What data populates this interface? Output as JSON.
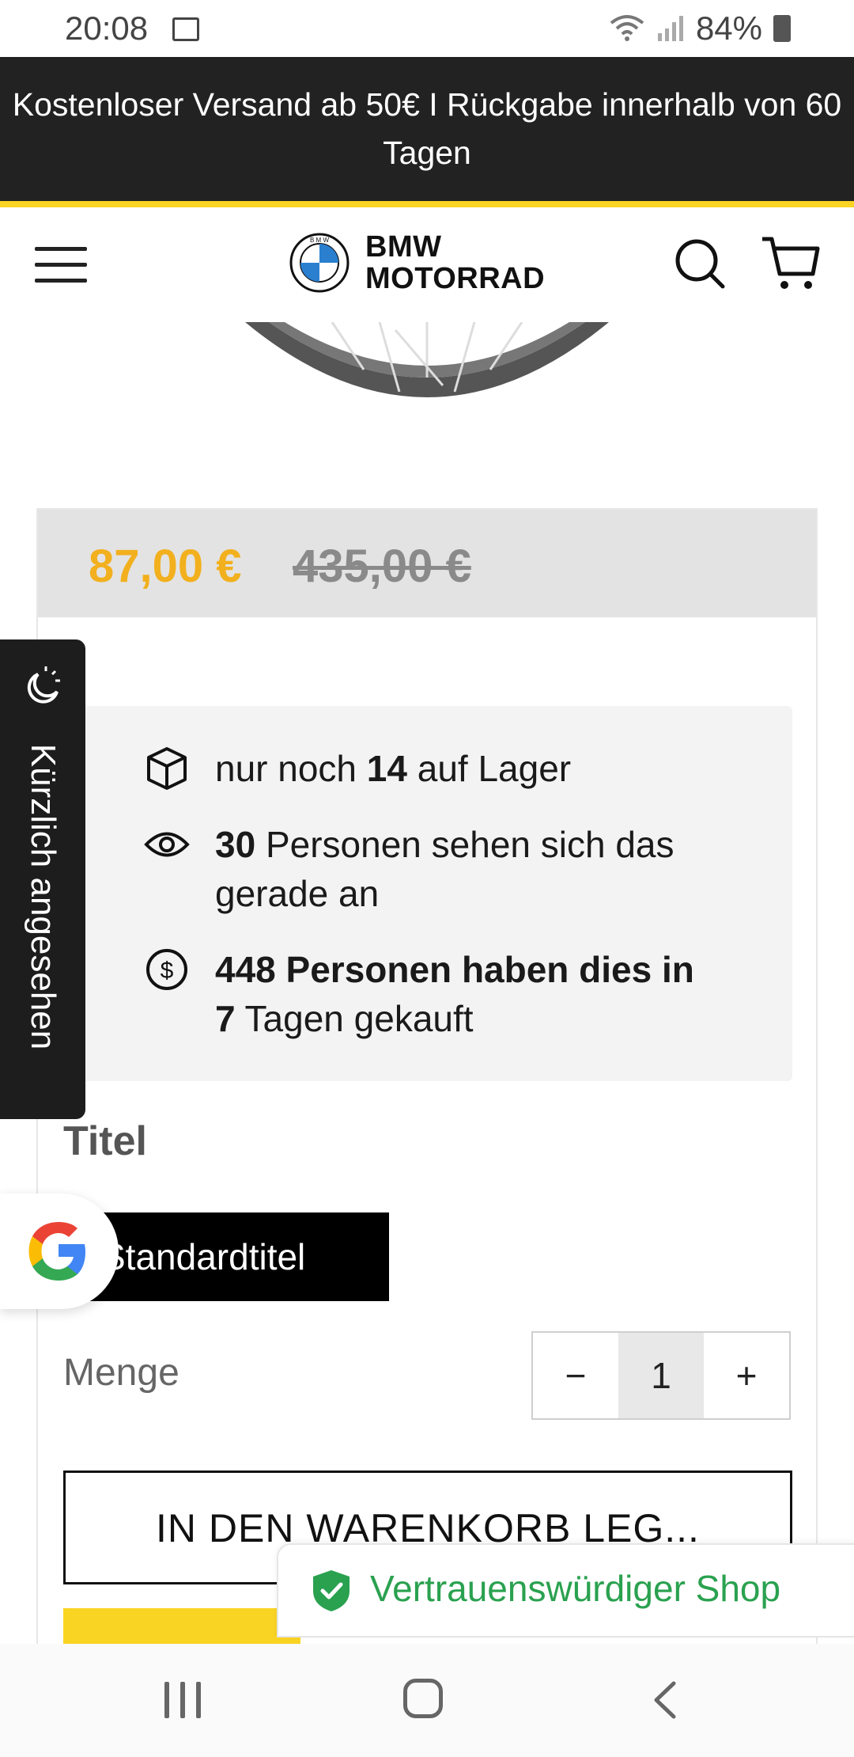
{
  "status_bar": {
    "time": "20:08",
    "battery": "84%"
  },
  "announcement": {
    "text": "Kostenloser Versand ab 50€ I Rückgabe innerhalb von 60 Tagen"
  },
  "header": {
    "brand_line1": "BMW",
    "brand_line2": "MOTORRAD",
    "logo_letters": "B M W"
  },
  "colors": {
    "accent_yellow": "#f9d423",
    "sale_price": "#f2b01e",
    "trust_green": "#2aa14f",
    "dark": "#222222"
  },
  "pricing": {
    "sale_price": "87,00 €",
    "original_price": "435,00 €"
  },
  "info": {
    "stock_prefix": "nur noch ",
    "stock_count": "14",
    "stock_suffix": " auf Lager",
    "viewers_count": "30",
    "viewers_suffix": " Personen sehen sich das gerade an",
    "purchased_bold": "448 Personen haben dies in 7",
    "purchased_suffix": " Tagen gekauft"
  },
  "recently_viewed": {
    "label": "Kürzlich angesehen"
  },
  "variant": {
    "label": "Titel",
    "selected": "Standardtitel"
  },
  "quantity": {
    "label": "Menge",
    "value": "1",
    "minus": "−",
    "plus": "+"
  },
  "actions": {
    "add_to_cart": "IN DEN WARENKORB LEG..."
  },
  "trust_badge": {
    "text": "Vertrauenswürdiger Shop"
  },
  "icons": [
    "image-icon",
    "wifi-icon",
    "signal-icon",
    "battery-icon",
    "menu-icon",
    "bmw-roundel-icon",
    "search-icon",
    "cart-icon",
    "box-icon",
    "eye-icon",
    "dollar-icon",
    "recent-icon",
    "google-icon",
    "shield-check-icon"
  ]
}
